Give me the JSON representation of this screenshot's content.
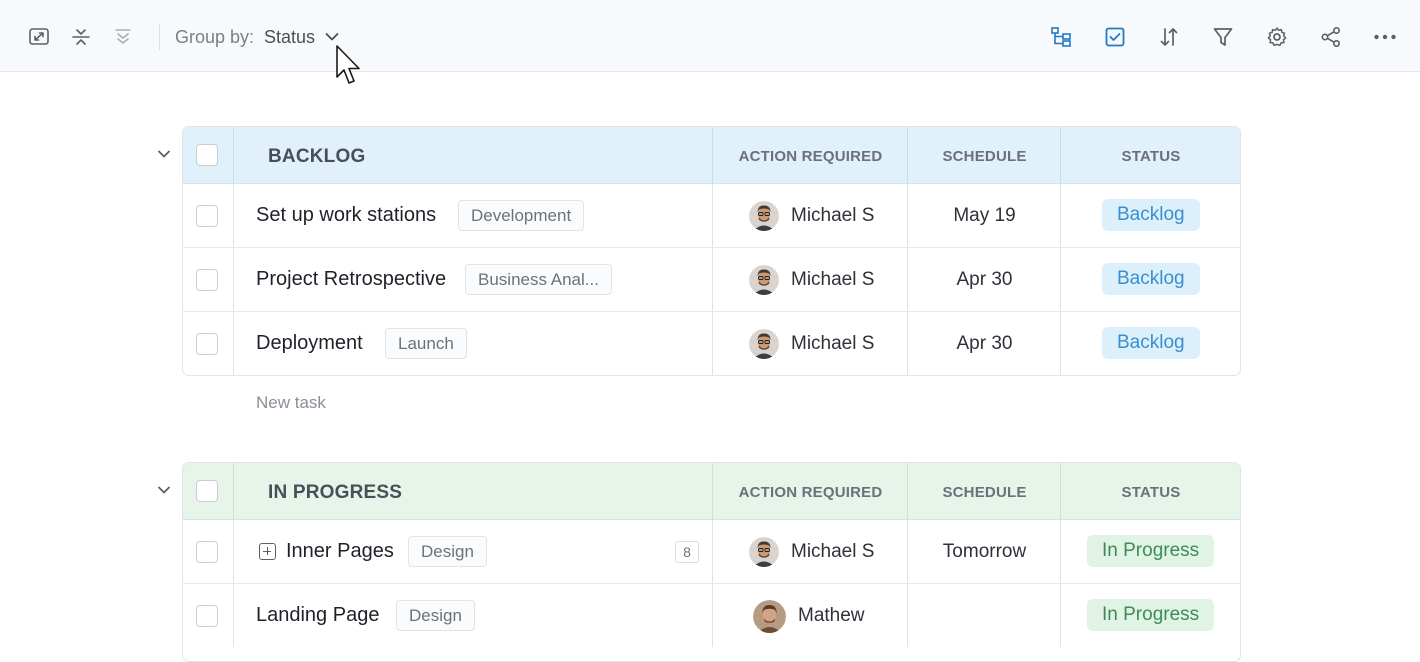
{
  "toolbar": {
    "groupby_label": "Group by:",
    "groupby_value": "Status"
  },
  "groups": [
    {
      "title": "BACKLOG",
      "columns": [
        "ACTION REQUIRED",
        "SCHEDULE",
        "STATUS"
      ],
      "rows": [
        {
          "name": "Set up work stations",
          "tag": "Development",
          "assignee": "Michael S",
          "schedule": "May 19",
          "status": "Backlog"
        },
        {
          "name": "Project Retrospective",
          "tag": "Business Anal...",
          "assignee": "Michael S",
          "schedule": "Apr 30",
          "status": "Backlog"
        },
        {
          "name": "Deployment",
          "tag": "Launch",
          "assignee": "Michael S",
          "schedule": "Apr 30",
          "status": "Backlog"
        }
      ],
      "new_task": "New task"
    },
    {
      "title": "IN PROGRESS",
      "columns": [
        "ACTION REQUIRED",
        "SCHEDULE",
        "STATUS"
      ],
      "rows": [
        {
          "name": "Inner Pages",
          "tag": "Design",
          "subtask_count": "8",
          "assignee": "Michael S",
          "schedule": "Tomorrow",
          "status": "In Progress"
        },
        {
          "name": "Landing Page",
          "tag": "Design",
          "assignee": "Mathew",
          "schedule": "",
          "status": "In Progress"
        }
      ]
    }
  ],
  "colors": {
    "backlog_header": "#e1f1fc",
    "inprogress_header": "#e6f4e9",
    "backlog_status": "#3b8fd0",
    "inprogress_status": "#3f8b55",
    "accent_icon": "#1f7ac4"
  },
  "icons": {
    "toolbar_left": [
      "expand-icon",
      "collapse-all-icon",
      "filter-down-icon"
    ],
    "toolbar_right": [
      "hierarchy-icon",
      "checkbox-icon",
      "sort-icon",
      "filter-icon",
      "settings-icon",
      "share-icon",
      "more-icon"
    ]
  }
}
